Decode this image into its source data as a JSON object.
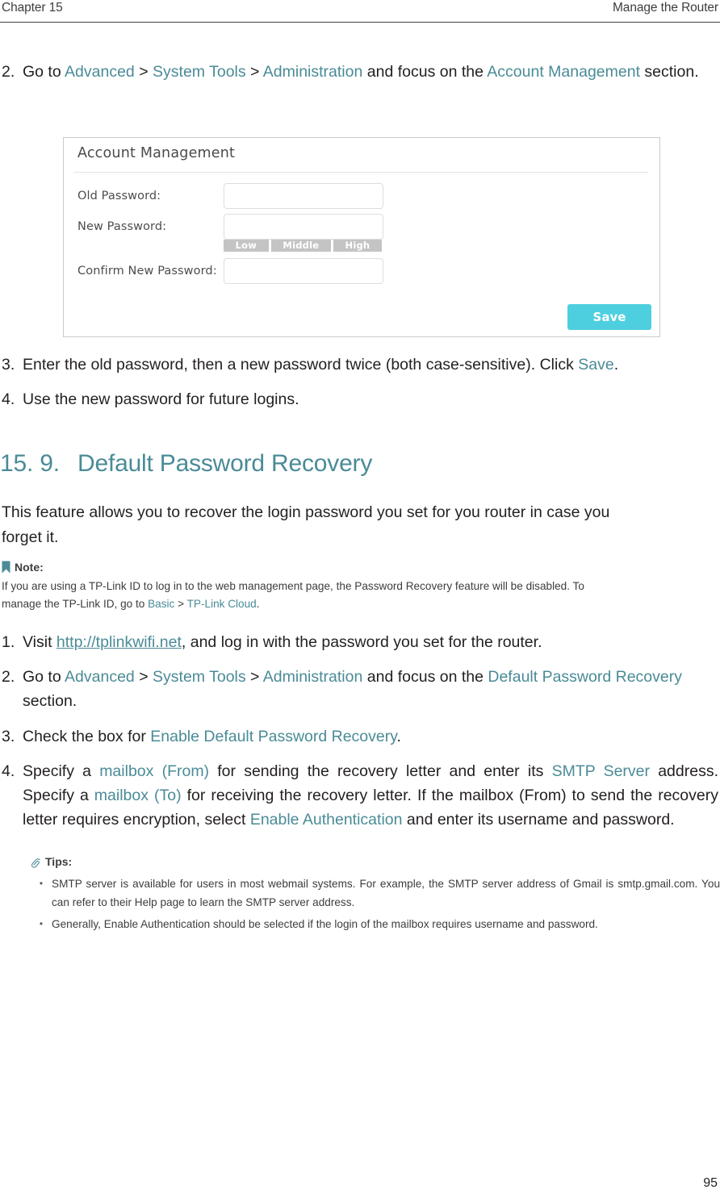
{
  "header": {
    "chapter": "Chapter 15",
    "section": "Manage the Router"
  },
  "step2": {
    "number": "2.",
    "t1": "Go to ",
    "link1": "Advanced",
    "sep1": " > ",
    "link2": "System Tools",
    "sep2": " > ",
    "link3": "Administration",
    "t2": " and focus on the ",
    "link4": "Account Management",
    "t3": " section."
  },
  "screenshot": {
    "title": "Account Management",
    "fields": [
      {
        "label": "Old Password:",
        "value": ""
      },
      {
        "label": "New Password:",
        "value": ""
      },
      {
        "label": "Confirm New Password:",
        "value": ""
      }
    ],
    "strength": [
      "Low",
      "Middle",
      "High"
    ],
    "save_label": "Save",
    "accent_color": "#4ecfdf",
    "strength_color": "#c4c4c4"
  },
  "step3": {
    "number": "3.",
    "t1": "Enter the old password, then a new password twice (both case-sensitive).  Click ",
    "link1": "Save",
    "t2": "."
  },
  "step4": {
    "number": "4.",
    "t1": "Use the new password for future logins."
  },
  "section_heading": {
    "number": "15. 9.",
    "title": "Default Password Recovery",
    "color": "#4a8b97"
  },
  "intro": {
    "line1": "This feature allows you to recover the login password you set for you router in case you",
    "line2": "forget it."
  },
  "note": {
    "icon": "bookmark-icon",
    "label": "Note:",
    "line1": "If you are using a TP-Link ID to log in to the web management page, the Password Recovery feature will be disabled. To",
    "line2_a": "manage the TP-Link ID, go to ",
    "link1": "Basic",
    "sep": " > ",
    "link2": "TP-Link Cloud",
    "line2_b": "."
  },
  "steps": [
    {
      "number": "1.",
      "t1": "Visit ",
      "link1": "http://tplinkwifi.net",
      "t2": ", and log in with the password you set for the router."
    },
    {
      "number": "2.",
      "t1": "Go to ",
      "link1": "Advanced",
      "sep1": " > ",
      "link2": "System Tools",
      "sep2": " > ",
      "link3": "Administration",
      "t2": " and focus on the ",
      "link4": "Default Password Recovery",
      "t3": " section."
    },
    {
      "number": "3.",
      "t1": "Check the box for ",
      "link1": "Enable Default Password Recovery",
      "t2": "."
    },
    {
      "number": "4.",
      "t1": "Specify a ",
      "link1": "mailbox (From)",
      "t2": " for sending the recovery letter and enter its ",
      "link2": "SMTP Server",
      "t3": " address. Specify a ",
      "link3": "mailbox (To)",
      "t4": " for receiving the recovery letter. If the mailbox (From) to send the recovery letter requires encryption, select ",
      "link4": "Enable Authentication",
      "t5": " and enter its username and password."
    }
  ],
  "tips": {
    "icon": "paperclip-icon",
    "label": "Tips:",
    "items": [
      "SMTP server is available for users in most webmail systems. For example, the SMTP server address of Gmail is smtp.gmail.com. You can refer to their Help page to learn the SMTP server address.",
      "Generally, Enable Authentication should be selected if the login of the mailbox requires username and password."
    ],
    "bullet": "•"
  },
  "footer": {
    "page_number": "95"
  }
}
